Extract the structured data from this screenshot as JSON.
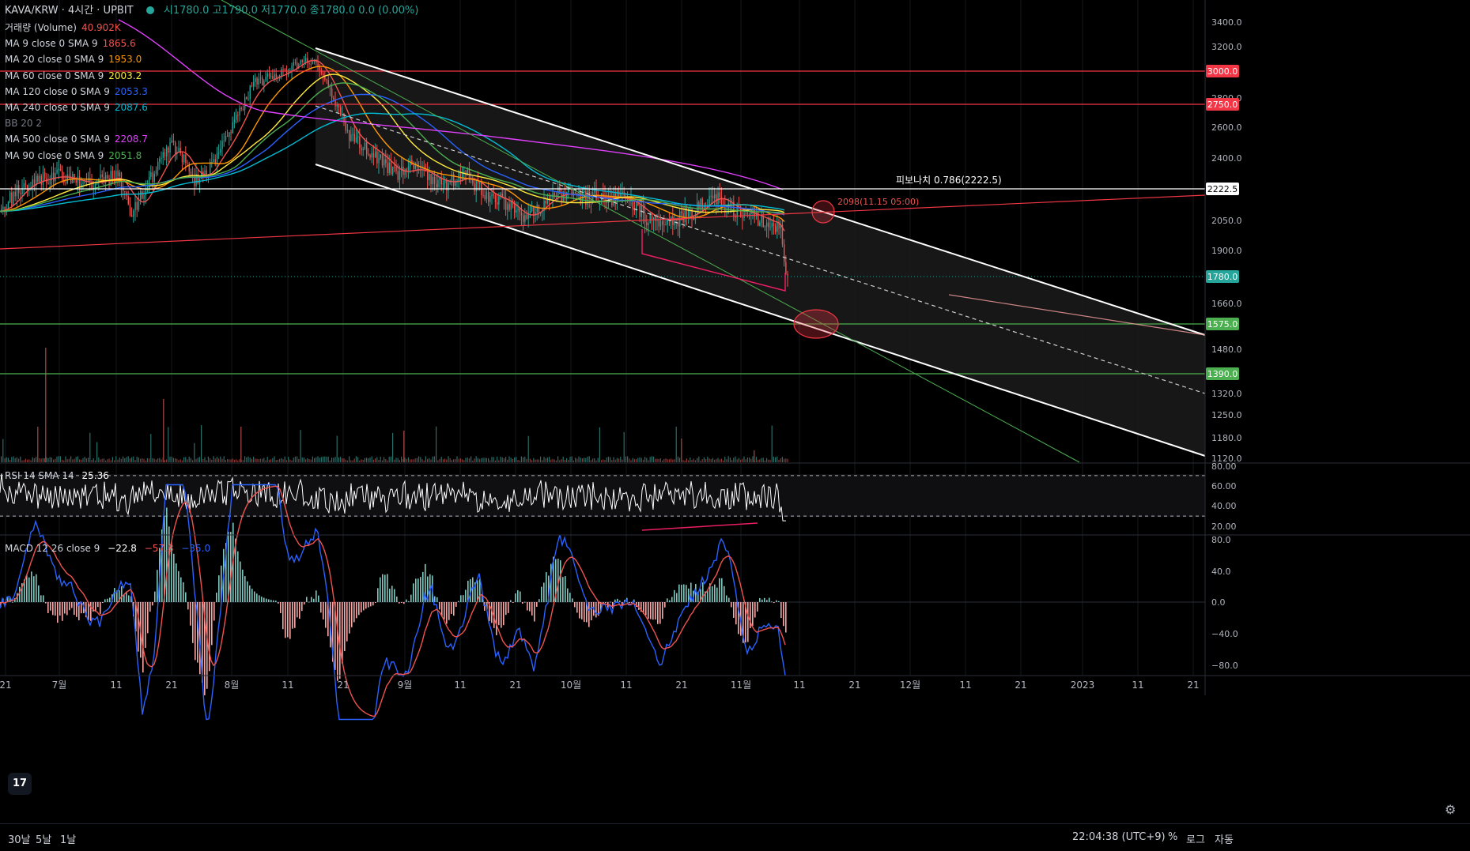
{
  "header": {
    "symbol": "KAVA/KRW · 4시간 · UPBIT",
    "ohlc": "시1780.0 고1790.0 저1770.0 종1780.0 0.0 (0.00%)"
  },
  "legend": [
    {
      "label": "거래량 (Volume)",
      "value": "40.902K",
      "color": "#ef5350"
    },
    {
      "label": "MA 9 close 0 SMA 9",
      "value": "1865.6",
      "color": "#ef5350"
    },
    {
      "label": "MA 20 close 0 SMA 9",
      "value": "1953.0",
      "color": "#ff9800"
    },
    {
      "label": "MA 60 close 0 SMA 9",
      "value": "2003.2",
      "color": "#ffeb3b"
    },
    {
      "label": "MA 120 close 0 SMA 9",
      "value": "2053.3",
      "color": "#2962ff"
    },
    {
      "label": "MA 240 close 0 SMA 9",
      "value": "2087.6",
      "color": "#00bcd4"
    },
    {
      "label": "BB 20 2",
      "value": "",
      "color": "#787b86"
    },
    {
      "label": "MA 500 close 0 SMA 9",
      "value": "2208.7",
      "color": "#e040fb"
    },
    {
      "label": "MA 90 close 0 SMA 9",
      "value": "2051.8",
      "color": "#4caf50"
    }
  ],
  "rsi_legend": {
    "label": "RSI 14 SMA 14",
    "value": "25.36"
  },
  "macd_legend": {
    "label": "MACD 12 26 close 9",
    "v1": "−22.8",
    "v2": "−57.8",
    "v3": "−35.0"
  },
  "fib_label": "피보나치 0.786(2222.5)",
  "annotation": "2098(11.15 05:00)",
  "price_axis_ticks": [
    "3400.0",
    "3200.0",
    "2800.0",
    "2600.0",
    "2400.0",
    "2050.0",
    "1900.0",
    "1660.0",
    "1480.0",
    "1320.0",
    "1250.0",
    "1180.0",
    "1120.0"
  ],
  "price_badges": [
    {
      "text": "3000.0",
      "color": "#f23645"
    },
    {
      "text": "2750.0",
      "color": "#f23645"
    },
    {
      "text": "2222.5",
      "color": "#ffffff"
    },
    {
      "text": "1780.0",
      "color": "#26a69a"
    },
    {
      "text": "1575.0",
      "color": "#4caf50"
    },
    {
      "text": "1390.0",
      "color": "#4caf50"
    }
  ],
  "rsi_axis_ticks": [
    "80.00",
    "60.00",
    "40.00",
    "20.00"
  ],
  "macd_axis_ticks": [
    "80.0",
    "40.0",
    "0.0",
    "−40.0",
    "−80.0"
  ],
  "time_axis_labels": [
    "21",
    "7월",
    "11",
    "21",
    "8월",
    "11",
    "21",
    "9월",
    "11",
    "21",
    "10월",
    "11",
    "21",
    "11월",
    "11",
    "21",
    "12월",
    "11",
    "21",
    "2023",
    "11",
    "21"
  ],
  "bottom": {
    "ranges": [
      "30날",
      "5날",
      "1날"
    ],
    "clock": "22:04:38 (UTC+9)",
    "percent": "%",
    "log": "로그",
    "auto": "자동"
  },
  "chart_data": {
    "type": "candlestick",
    "symbol": "KAVA/KRW",
    "interval": "4h",
    "price_range": [
      1120,
      3400
    ],
    "last_close": 1780.0,
    "horizontal_levels": [
      3000.0,
      2750.0,
      2222.5,
      1575.0,
      1390.0
    ],
    "rsi_range": [
      20,
      80
    ],
    "rsi_last": 25.36,
    "macd_range": [
      -80,
      80
    ],
    "macd_last": {
      "macd": -22.8,
      "signal": -57.8,
      "hist": -35.0
    }
  }
}
